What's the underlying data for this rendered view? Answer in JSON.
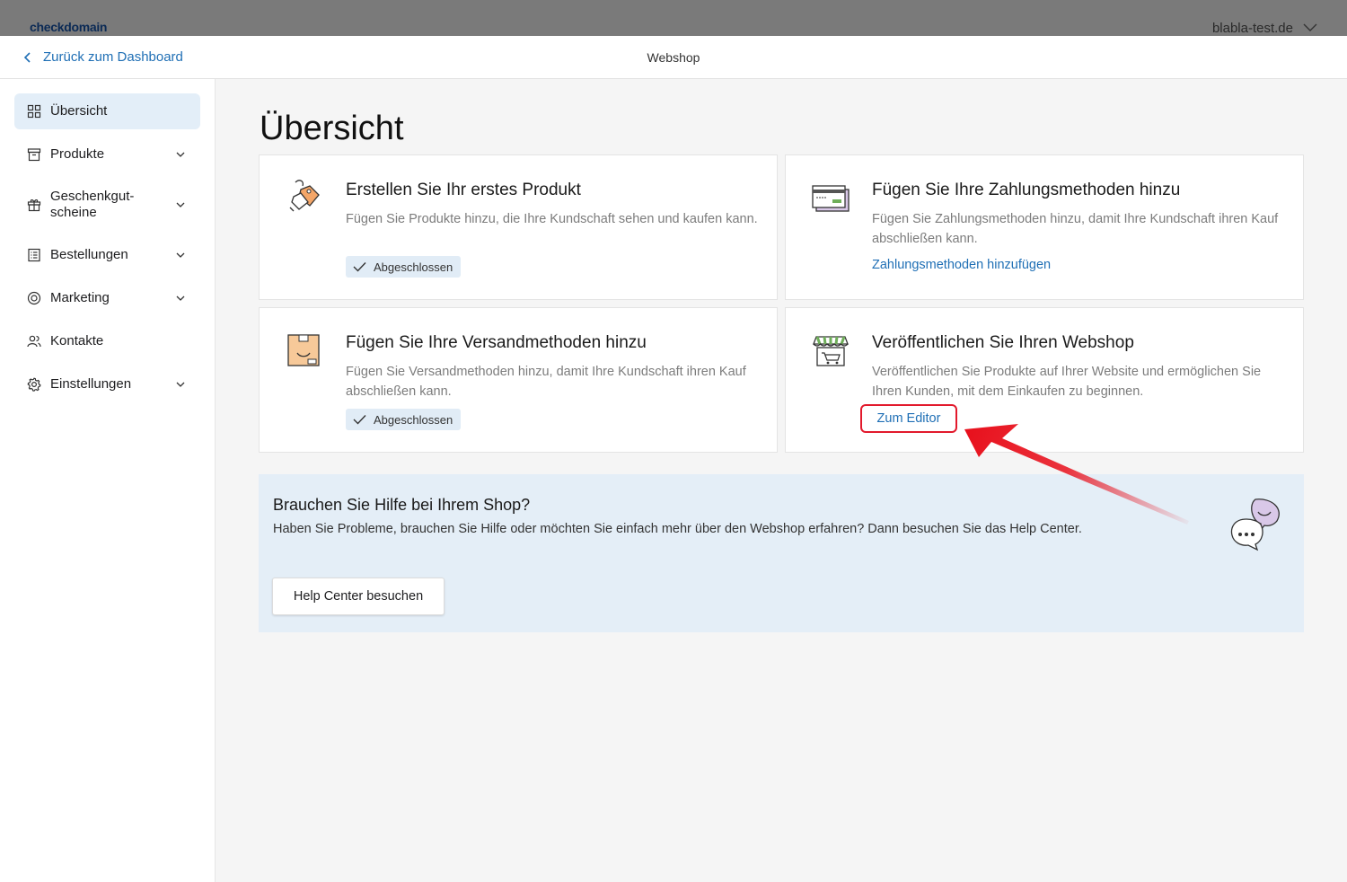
{
  "topbar": {
    "brand": "checkdomain",
    "domain": "blabla-test.de"
  },
  "subheader": {
    "back_label": "Zurück zum Dashboard",
    "title": "Webshop"
  },
  "sidebar": {
    "items": [
      {
        "label": "Übersicht",
        "icon": "grid-icon",
        "active": true
      },
      {
        "label": "Produkte",
        "icon": "archive-box-icon"
      },
      {
        "label": "Geschenkgut-\nscheine",
        "icon": "gift-icon"
      },
      {
        "label": "Bestellungen",
        "icon": "list-document-icon"
      },
      {
        "label": "Marketing",
        "icon": "target-icon"
      },
      {
        "label": "Kontakte",
        "icon": "people-icon"
      },
      {
        "label": "Einstellungen",
        "icon": "gear-icon"
      }
    ]
  },
  "main": {
    "title": "Übersicht",
    "cards": [
      {
        "title": "Erstellen Sie Ihr erstes Produkt",
        "description": "Fügen Sie Produkte hinzu, die Ihre Kundschaft sehen und kaufen kann.",
        "badge": "Abgeschlossen"
      },
      {
        "title": "Fügen Sie Ihre Zahlungsmethoden hinzu",
        "description": "Fügen Sie Zahlungsmethoden hinzu, damit Ihre Kundschaft ihren Kauf abschließen kann.",
        "link": "Zahlungsmethoden hinzufügen"
      },
      {
        "title": "Fügen Sie Ihre Versandmethoden hinzu",
        "description": "Fügen Sie Versandmethoden hinzu, damit Ihre Kundschaft ihren Kauf abschließen kann.",
        "badge": "Abgeschlossen"
      },
      {
        "title": "Veröffentlichen Sie Ihren Webshop",
        "description": "Veröffentlichen Sie Produkte auf Ihrer Website und ermöglichen Sie Ihren Kunden, mit dem Einkaufen zu beginnen.",
        "link": "Zum Editor"
      }
    ],
    "help": {
      "title": "Brauchen Sie Hilfe bei Ihrem Shop?",
      "description": "Haben Sie Probleme, brauchen Sie Hilfe oder möchten Sie einfach mehr über den Webshop erfahren? Dann besuchen Sie das Help Center.",
      "button": "Help Center besuchen"
    }
  },
  "colors": {
    "accent": "#1f6fb5",
    "highlight_box": "#e2192c",
    "annotation_arrow": "#e8101c",
    "active_nav_bg": "#e3eef8",
    "badge_bg": "#e1ecf6",
    "help_bg": "#e4eef7"
  }
}
